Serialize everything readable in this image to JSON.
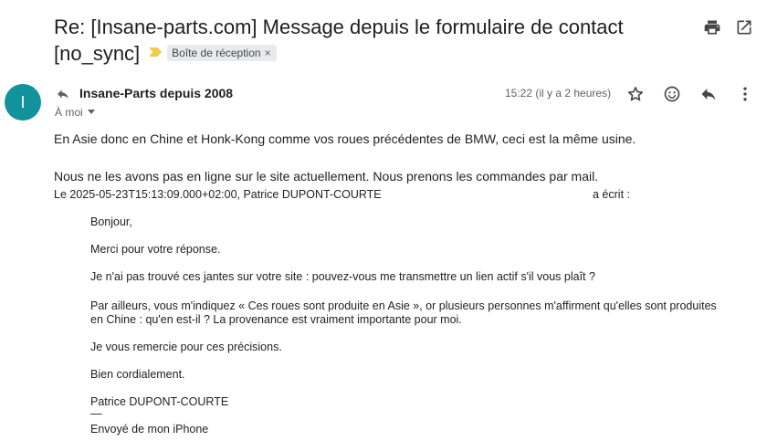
{
  "subject": {
    "title_line1": "Re: [Insane-parts.com] Message depuis le formulaire de contact",
    "title_line2": "[no_sync]",
    "label": "Boîte de réception",
    "label_remove": "×"
  },
  "toolbar": {
    "print_icon": "print-icon",
    "popout_icon": "open-in-new-window-icon"
  },
  "message": {
    "avatar_letter": "I",
    "sender": "Insane-Parts depuis 2008",
    "to": "À moi",
    "date": "15:22 (il y a 2 heures)",
    "icons": [
      "star-icon",
      "emoji-icon",
      "reply-icon",
      "more-vert-icon"
    ],
    "body_line1": "En Asie donc en Chine et Honk-Kong comme vos roues précédentes de BMW, ceci est la même usine.",
    "body_line2": "Nous ne les avons pas en ligne sur le site actuellement. Nous prenons les commandes par mail.",
    "attribution": "Le 2025-05-23T15:13:09.000+02:00, Patrice DUPONT-COURTE",
    "attribution_end": "a écrit :"
  },
  "quote": {
    "greeting": "Bonjour,",
    "thanks": "Merci pour votre réponse.",
    "q1": "Je n'ai pas trouvé ces jantes sur votre site : pouvez-vous me transmettre un lien actif s'il vous plaît ?",
    "q2": "Par ailleurs, vous m'indiquez « Ces roues sont produite en Asie », or plusieurs personnes m'affirment qu'elles sont produites en Chine : qu'en est-il ? La provenance est vraiment importante pour moi.",
    "thanks2": "Je vous remercie pour ces précisions.",
    "closing": "Bien cordialement.",
    "signature": "Patrice DUPONT-COURTE",
    "dash": "—",
    "sent_from": "Envoyé de mon iPhone"
  }
}
